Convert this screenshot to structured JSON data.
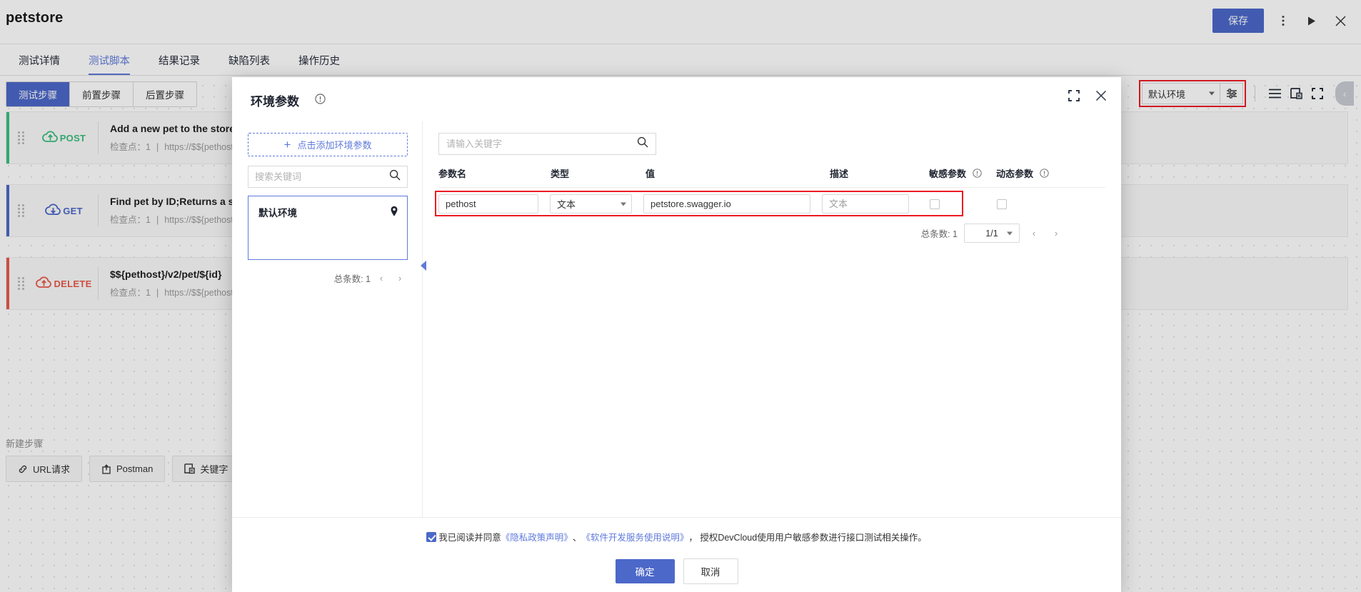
{
  "app": {
    "title": "petstore",
    "save_label": "保存"
  },
  "nav_tabs": [
    {
      "label": "测试详情",
      "active": false
    },
    {
      "label": "测试脚本",
      "active": true
    },
    {
      "label": "结果记录",
      "active": false
    },
    {
      "label": "缺陷列表",
      "active": false
    },
    {
      "label": "操作历史",
      "active": false
    }
  ],
  "segmented": [
    {
      "label": "测试步骤",
      "active": true
    },
    {
      "label": "前置步骤",
      "active": false
    },
    {
      "label": "后置步骤",
      "active": false
    }
  ],
  "toolbar": {
    "env_value": "默认环境",
    "gear_icon": "settings-sliders-icon",
    "list_icon": "list-icon",
    "import_icon": "keyword-import-icon",
    "fullscreen_icon": "fullscreen-icon",
    "collapse_icon": "‹"
  },
  "steps": [
    {
      "method": "POST",
      "accent": "#3bbf7d",
      "title": "Add a new pet to the store",
      "checkpoint_label": "检查点：",
      "checkpoint_value": "1",
      "url": "https://$${pethost}/v"
    },
    {
      "method": "GET",
      "accent": "#4c68c9",
      "title": "Find pet by ID;Returns a sin",
      "checkpoint_label": "检查点：",
      "checkpoint_value": "1",
      "url": "https://$${pethost}/v"
    },
    {
      "method": "DELETE",
      "accent": "#e8594a",
      "title": "$${pethost}/v2/pet/${id}",
      "checkpoint_label": "检查点：",
      "checkpoint_value": "1",
      "url": "https://$${pethost}/v"
    }
  ],
  "new_step": {
    "label": "新建步骤",
    "buttons": [
      {
        "label": "URL请求",
        "icon": "link-icon"
      },
      {
        "label": "Postman",
        "icon": "postman-import-icon"
      },
      {
        "label": "关键字",
        "icon": "keyword-icon"
      }
    ]
  },
  "modal": {
    "title": "环境参数",
    "title_info_icon": "info-circle-icon",
    "fullscreen_icon": "fullscreen-icon",
    "close_icon": "close-icon",
    "env_panel": {
      "add_label": "点击添加环境参数",
      "add_icon": "plus-icon",
      "search_placeholder": "搜索关键词",
      "search_value": "",
      "search_icon": "search-icon",
      "items": [
        {
          "label": "默认环境",
          "icon": "location-pin-icon"
        }
      ],
      "total_label": "总条数: 1",
      "prev_icon": "‹",
      "next_icon": "›"
    },
    "params_panel": {
      "search_placeholder": "请输入关键字",
      "search_value": "",
      "search_icon": "search-icon",
      "columns": [
        {
          "key": "name",
          "label": "参数名",
          "info": false
        },
        {
          "key": "type",
          "label": "类型",
          "info": false
        },
        {
          "key": "value",
          "label": "值",
          "info": false
        },
        {
          "key": "desc",
          "label": "描述",
          "info": false
        },
        {
          "key": "sens",
          "label": "敏感参数",
          "info": true
        },
        {
          "key": "dyn",
          "label": "动态参数",
          "info": true
        }
      ],
      "rows": [
        {
          "name": "pethost",
          "type": "文本",
          "value": "petstore.swagger.io",
          "desc_placeholder": "文本",
          "desc": "",
          "sensitive": false,
          "dynamic": false
        }
      ],
      "total_label": "总条数: 1",
      "page_value": "1/1",
      "prev_icon": "‹",
      "next_icon": "›"
    },
    "footer": {
      "agree_prefix": "我已阅读并同意",
      "link1": "《隐私政策声明》",
      "mid1": "、",
      "link2": "《软件开发服务使用说明》",
      "agree_suffix": "，  授权DevCloud使用用户敏感参数进行接口测试相关操作。",
      "agreed": true,
      "ok_label": "确定",
      "cancel_label": "取消"
    }
  },
  "colors": {
    "primary": "#4c68c9",
    "link": "#5f7ada",
    "annotation_red": "#ec1c24"
  }
}
